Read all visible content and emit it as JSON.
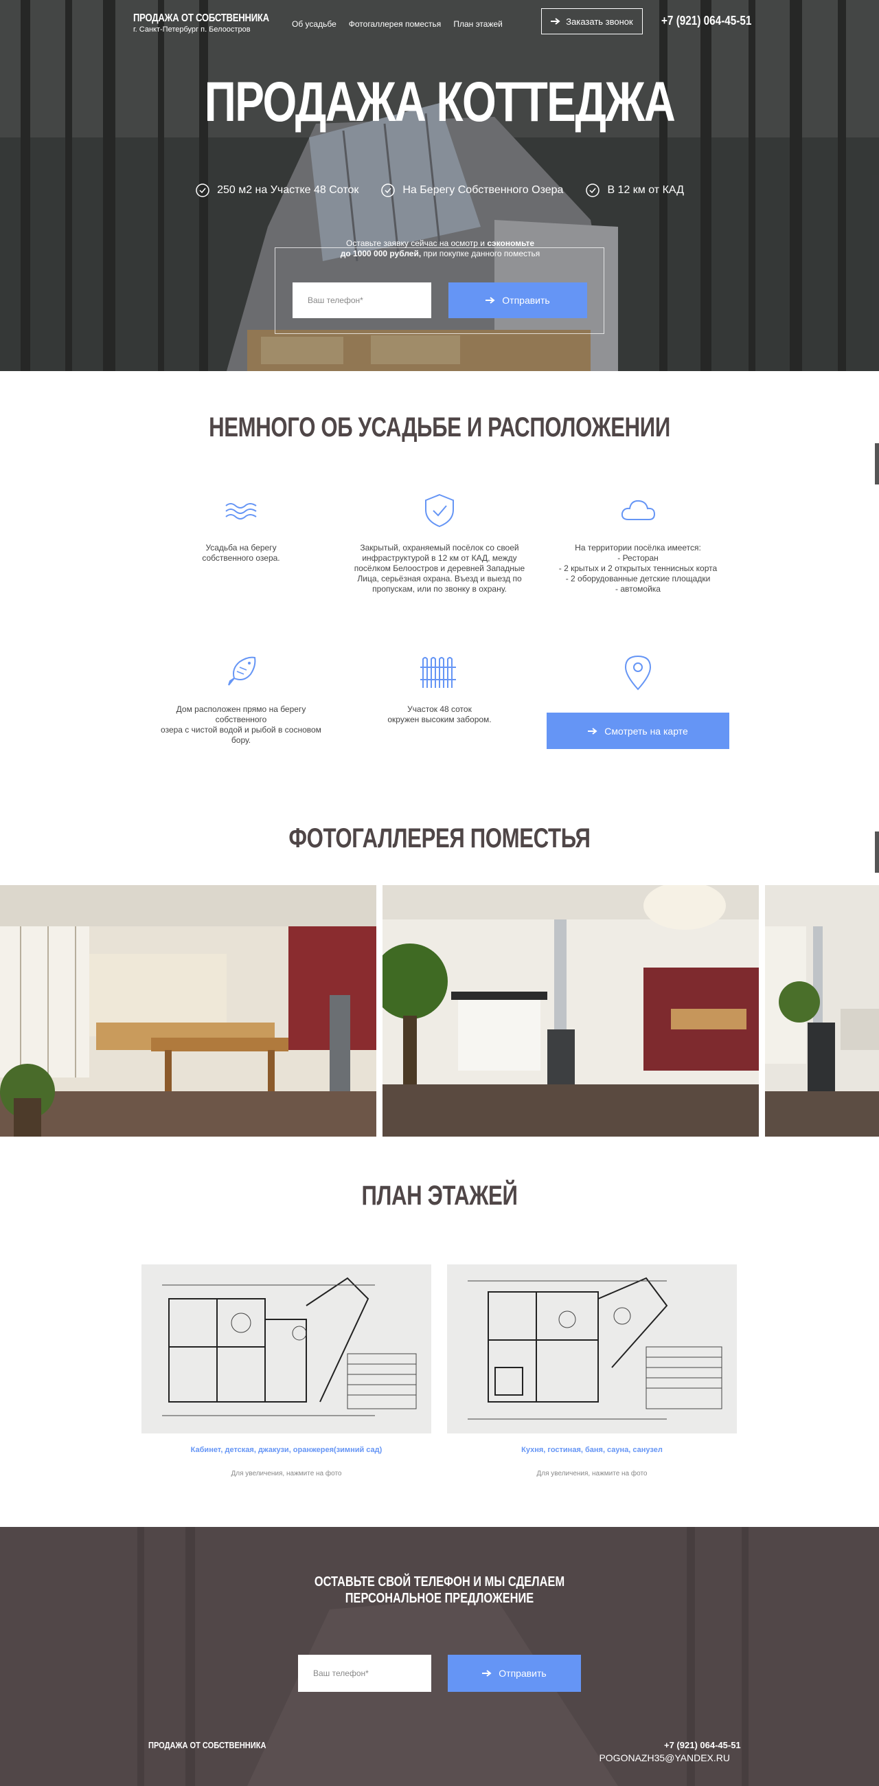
{
  "header": {
    "brand_title": "ПРОДАЖА ОТ СОБСТВЕННИКА",
    "brand_subtitle": "г. Санкт-Петербург п. Белоостров",
    "nav": [
      "Об усадьбе",
      "Фотогаллерея поместья",
      "План этажей"
    ],
    "call_button": "Заказать звонок",
    "phone": "+7 (921) 064-45-51"
  },
  "hero": {
    "title": "ПРОДАЖА КОТТЕДЖА",
    "features": [
      "250 м2 на Участке 48 Соток",
      "На Берегу Собственного Озера",
      "В 12 км от КАД"
    ],
    "offer_line1_prefix": "Оставьте заявку сейчас на осмотр и ",
    "offer_line1_bold": "сэкономьте",
    "offer_line2_bold": "до 1000 000 рублей,",
    "offer_line2_rest": " при покупке данного поместья",
    "phone_placeholder": "Ваш телефон*",
    "submit_label": "Отправить"
  },
  "about": {
    "title": "НЕМНОГО ОБ УСАДЬБЕ И РАСПОЛОЖЕНИИ",
    "items": [
      {
        "icon": "waves-icon",
        "text": "Усадьба на берегу\nсобственного озера."
      },
      {
        "icon": "shield-check-icon",
        "text": "Закрытый, охраняемый посёлок со своей\nинфраструктурой в 12 км от КАД, между\nпосёлком Белоостров и деревней Западные\nЛица, серьёзная охрана. Въезд и выезд по\nпропускам, или по звонку в охрану."
      },
      {
        "icon": "cloud-icon",
        "text": "На территории посёлка имеется:\n- Ресторан\n- 2 крытых и 2 открытых теннисных корта\n- 2 оборудованные детские площадки\n- автомойка"
      },
      {
        "icon": "fish-icon",
        "text": "Дом расположен прямо на берегу собственного\nозера с чистой водой и рыбой в сосновом бору."
      },
      {
        "icon": "fence-icon",
        "text": "Участок 48 соток\nокружен высоким забором."
      },
      {
        "icon": "map-pin-icon",
        "text": ""
      }
    ],
    "map_button": "Смотреть на карте"
  },
  "gallery": {
    "title": "ФОТОГАЛЛЕРЕЯ ПОМЕСТЬЯ"
  },
  "plans": {
    "title": "ПЛАН ЭТАЖЕЙ",
    "items": [
      {
        "caption": "Кабинет, детская, джакузи, оранжерея(зимний сад)",
        "hint": "Для увеличения, нажмите на фото"
      },
      {
        "caption": "Кухня, гостиная, баня, сауна, санузел",
        "hint": "Для увеличения, нажмите на фото"
      }
    ]
  },
  "footer": {
    "cta": "ОСТАВЬТЕ СВОЙ ТЕЛЕФОН И МЫ СДЕЛАЕМ\nПЕРСОНАЛЬНОЕ ПРЕДЛОЖЕНИЕ",
    "phone_placeholder": "Ваш телефон*",
    "submit_label": "Отправить",
    "brand": "ПРОДАЖА ОТ СОБСТВЕННИКА",
    "phone": "+7 (921) 064-45-51",
    "email": "POGONAZH35@YANDEX.RU"
  },
  "colors": {
    "accent": "#6595f5",
    "heading": "#4f4647",
    "footer_bg": "#504647"
  }
}
